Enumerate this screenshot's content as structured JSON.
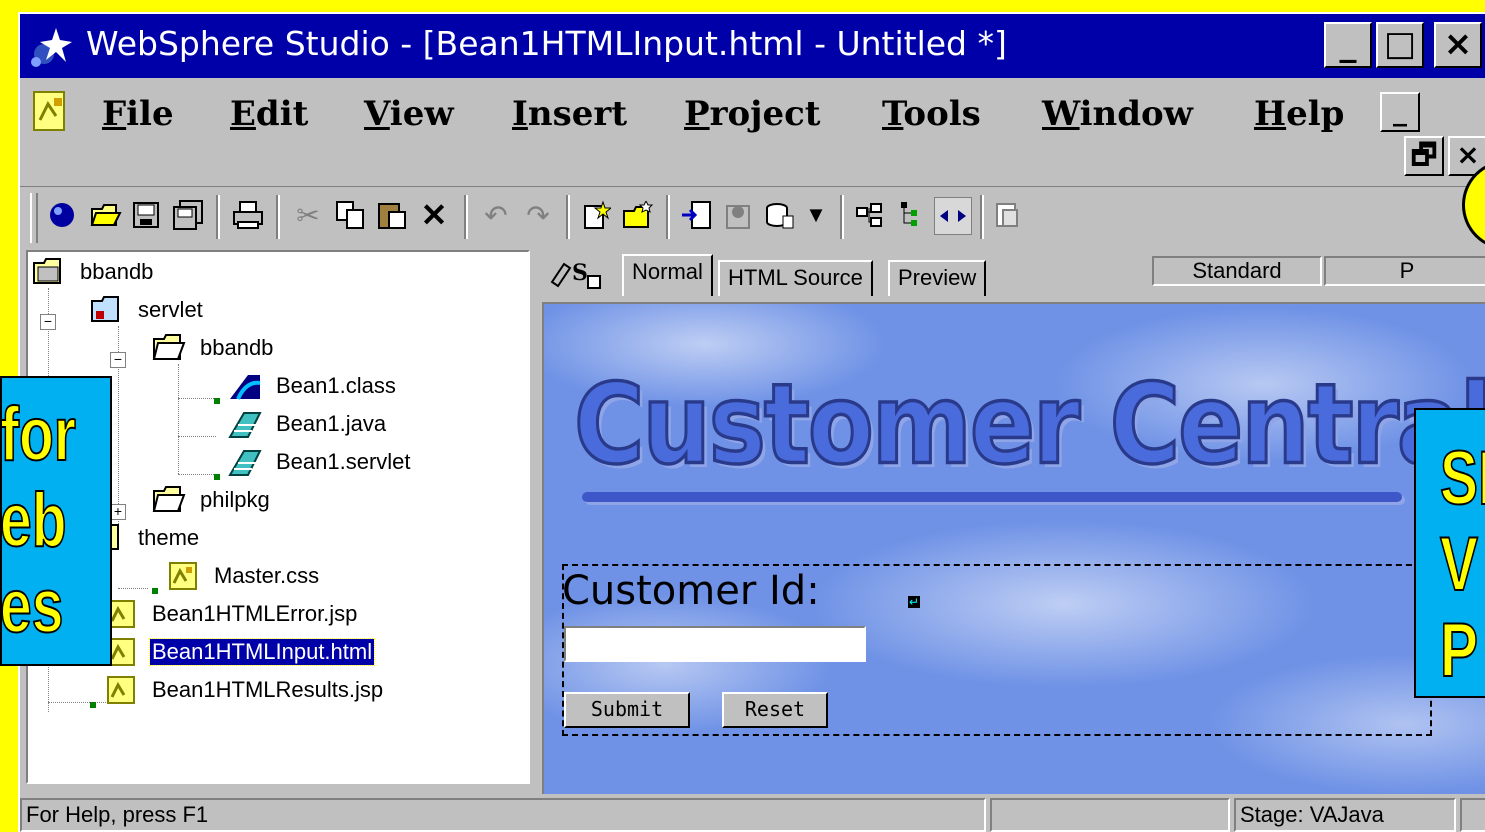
{
  "window": {
    "title": "WebSphere Studio - [Bean1HTMLInput.html - Untitled *]",
    "controls": {
      "minimize": "_",
      "maximize": "□",
      "close": "×"
    }
  },
  "menu": {
    "items": [
      {
        "key": "F",
        "rest": "ile"
      },
      {
        "key": "E",
        "rest": "dit"
      },
      {
        "key": "V",
        "rest": "iew"
      },
      {
        "key": "I",
        "rest": "nsert"
      },
      {
        "key": "P",
        "rest": "roject"
      },
      {
        "key": "T",
        "rest": "ools"
      },
      {
        "key": "W",
        "rest": "indow"
      },
      {
        "key": "H",
        "rest": "elp"
      }
    ],
    "mdi": {
      "minimize": "_",
      "restore": "🗗",
      "close": "×"
    }
  },
  "toolbar": {
    "icons": [
      "globe-icon",
      "open-folder-icon",
      "save-icon",
      "save-all-icon",
      "print-icon",
      "cut-icon",
      "copy-icon",
      "paste-icon",
      "delete-icon",
      "undo-icon",
      "redo-icon",
      "new-file-icon",
      "new-folder-icon",
      "insert-icon",
      "publish-icon",
      "database-icon",
      "dropdown-icon",
      "link-icon",
      "tree-icon",
      "arrows-icon",
      "page-icon"
    ]
  },
  "tree": {
    "items": [
      {
        "label": "bbandb",
        "icon": "project-icon"
      },
      {
        "label": "servlet",
        "icon": "servlet-folder-icon"
      },
      {
        "label": "bbandb",
        "icon": "folder-icon"
      },
      {
        "label": "Bean1.class",
        "icon": "class-icon"
      },
      {
        "label": "Bean1.java",
        "icon": "java-icon"
      },
      {
        "label": "Bean1.servlet",
        "icon": "java-icon"
      },
      {
        "label": "philpkg",
        "icon": "folder-icon"
      },
      {
        "label": "theme",
        "icon": "folder-icon"
      },
      {
        "label": "Master.css",
        "icon": "doc-icon"
      },
      {
        "label": "Bean1HTMLError.jsp",
        "icon": "doc-icon"
      },
      {
        "label": "Bean1HTMLInput.html",
        "icon": "doc-icon"
      },
      {
        "label": "Bean1HTMLResults.jsp",
        "icon": "doc-icon"
      }
    ]
  },
  "editor": {
    "tabs": [
      "Normal",
      "HTML Source",
      "Preview"
    ],
    "mode": "Standard",
    "mode2": "P"
  },
  "page": {
    "logo": "Customer Central",
    "customer_label": "Customer Id:",
    "submit": "Submit",
    "reset": "Reset"
  },
  "status": {
    "help": "For Help, press F1",
    "stage": "Stage: VAJava"
  },
  "callouts": {
    "left": "for\neb\nes",
    "right": "SI\nV\nP"
  },
  "colors": {
    "titlebar": "#0000a8",
    "background": "#FFFF00",
    "callout": "#00b0f0"
  }
}
